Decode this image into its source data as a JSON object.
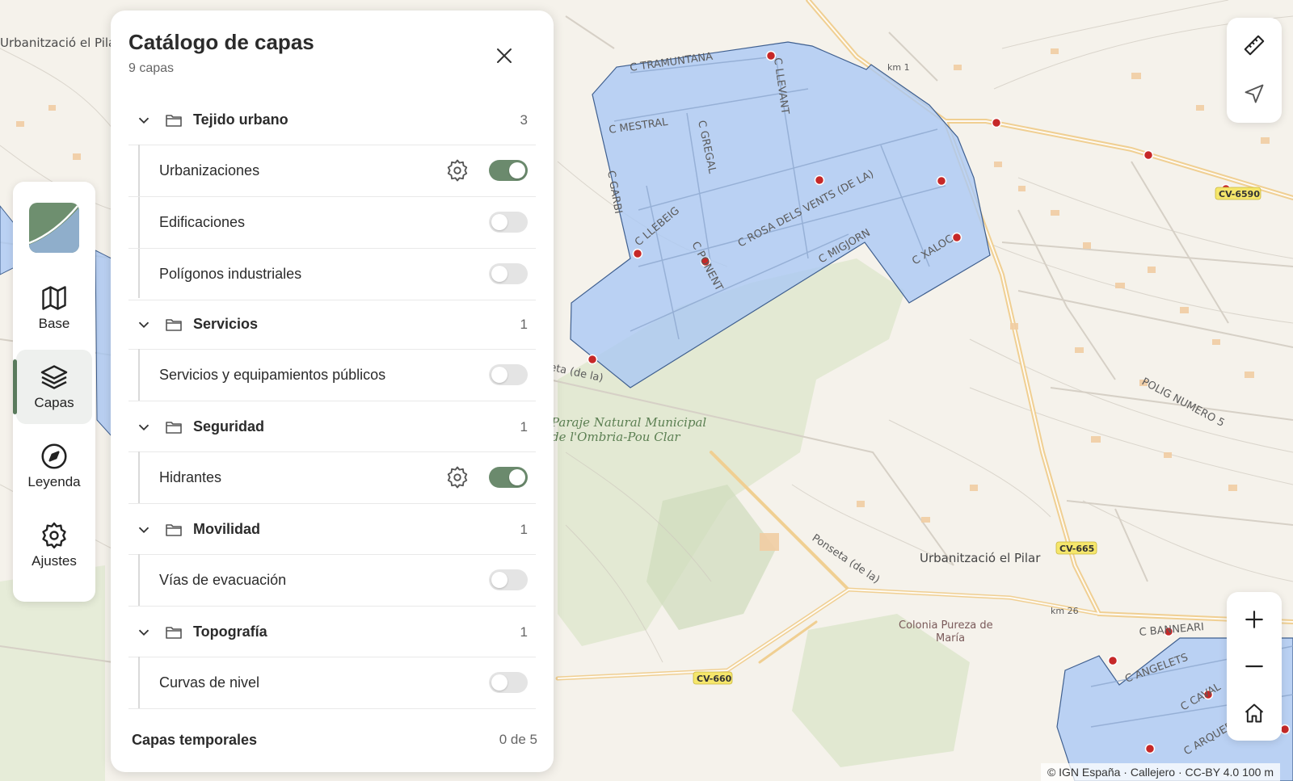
{
  "map": {
    "labels": {
      "urb_pilar_top": "Urbanització el Pilar",
      "urb_pilar_main": "Urbanització el Pilar",
      "tramuntana": "C TRAMUNTANA",
      "mestral": "C MESTRAL",
      "llevant": "C LLEVANT",
      "gregal": "C GREGAL",
      "garbi": "C GARBI",
      "llebeig": "C LLEBEIG",
      "ponent": "C PONENT",
      "rosa": "C ROSA DELS VENTS (DE LA)",
      "migjorn": "C MIGJORN",
      "xaloc": "C XALOC",
      "km1": "km 1",
      "km26": "km 26",
      "poligon": "POLIG NUMERO 5",
      "paraje1": "Paraje Natural Municipal",
      "paraje2": "de l'Ombria-Pou Clar",
      "ponseta": "Ponseta (de la)",
      "ponseta2": "Ponseta (de la)",
      "colonia1": "Colonia Pureza de",
      "colonia2": "María",
      "banneari": "C BANNEARI",
      "angelets": "C ANGELETS",
      "caval": "C CAVAL",
      "arquer": "C ARQUER",
      "cv6590": "CV-6590",
      "cv665": "CV-665",
      "cv660": "CV-660"
    },
    "colors": {
      "polygon_fill": "#a9c8f5",
      "polygon_stroke": "#3f5f8f",
      "road": "#f3d49a",
      "hydrant": "#c62828"
    }
  },
  "rail": {
    "items": [
      {
        "label": "Base",
        "icon": "map-icon",
        "active": false
      },
      {
        "label": "Capas",
        "icon": "layers-icon",
        "active": true
      },
      {
        "label": "Leyenda",
        "icon": "compass-icon",
        "active": false
      },
      {
        "label": "Ajustes",
        "icon": "gear-icon",
        "active": false
      }
    ]
  },
  "panel": {
    "title": "Catálogo de capas",
    "subtitle": "9 capas",
    "groups": [
      {
        "name": "Tejido urbano",
        "count": "3",
        "layers": [
          {
            "name": "Urbanizaciones",
            "on": true,
            "settings": true
          },
          {
            "name": "Edificaciones",
            "on": false,
            "settings": false
          },
          {
            "name": "Polígonos industriales",
            "on": false,
            "settings": false
          }
        ]
      },
      {
        "name": "Servicios",
        "count": "1",
        "layers": [
          {
            "name": "Servicios y equipamientos públicos",
            "on": false,
            "settings": false
          }
        ]
      },
      {
        "name": "Seguridad",
        "count": "1",
        "layers": [
          {
            "name": "Hidrantes",
            "on": true,
            "settings": true
          }
        ]
      },
      {
        "name": "Movilidad",
        "count": "1",
        "layers": [
          {
            "name": "Vías de evacuación",
            "on": false,
            "settings": false
          }
        ]
      },
      {
        "name": "Topografía",
        "count": "1",
        "layers": [
          {
            "name": "Curvas de nivel",
            "on": false,
            "settings": false
          }
        ]
      }
    ],
    "temporary": {
      "label": "Capas temporales",
      "count": "0 de 5"
    }
  },
  "controls": {
    "measure_icon": "ruler-icon",
    "locate_icon": "navigation-arrow-icon",
    "zoom_in_icon": "plus-icon",
    "zoom_out_icon": "minus-icon",
    "home_icon": "home-icon"
  },
  "attribution": "© IGN España · Callejero · CC-BY 4.0    100 m"
}
